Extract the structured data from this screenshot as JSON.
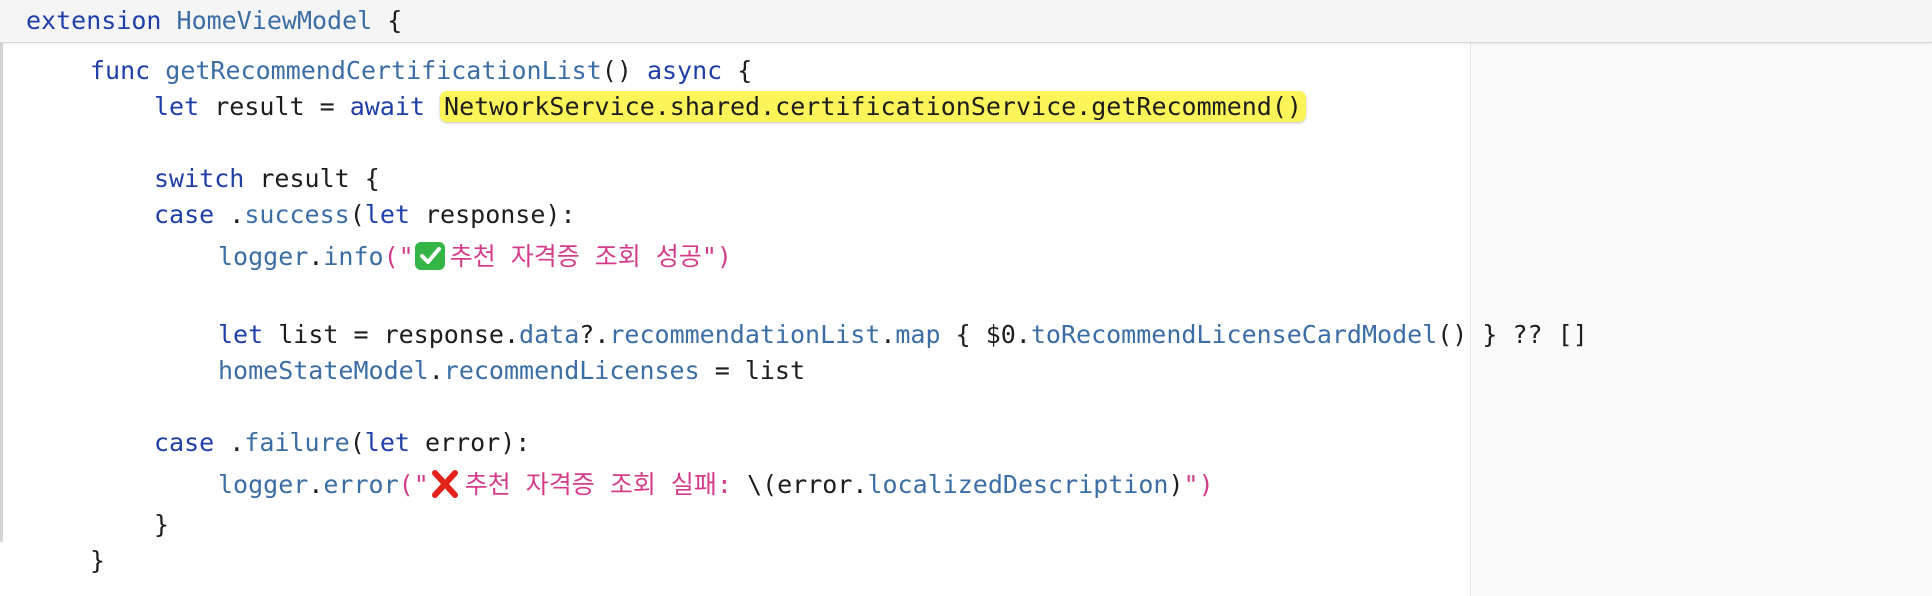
{
  "header": {
    "kw_extension": "extension",
    "type_name": "HomeViewModel",
    "brace": " {"
  },
  "code": {
    "l1": {
      "kw_func": "func",
      "fn_name": "getRecommendCertificationList",
      "parens": "()",
      "kw_async": "async",
      "brace": "{"
    },
    "l2": {
      "kw_let": "let",
      "plain": "result =",
      "kw_await": "await",
      "highlighted_call": "NetworkService.shared.certificationService.getRecommend()"
    },
    "l3": {
      "kw_switch": "switch",
      "plain": "result {"
    },
    "l4": {
      "kw_case": "case",
      "dot": ".",
      "member": "success",
      "open": "(",
      "kw_let": "let",
      "plain": "response):"
    },
    "l5": {
      "obj": "logger",
      "dot": ".",
      "method": "info",
      "open": "(\"",
      "str": "추천 자격증 조회 성공",
      "close": "\")"
    },
    "l6": {
      "kw_let": "let",
      "p1": "list = response.",
      "m1": "data",
      "p2": "?.",
      "m2": "recommendationList",
      "p3": ".",
      "m3": "map",
      "p4": "{ $0.",
      "m4": "toRecommendLicenseCardModel",
      "p5": "() } ?? []"
    },
    "l7": {
      "m1": "homeStateModel",
      "p1": ".",
      "m2": "recommendLicenses",
      "p2": "= list"
    },
    "l8": {
      "kw_case": "case",
      "dot": ".",
      "member": "failure",
      "open": "(",
      "kw_let": "let",
      "plain": "error):"
    },
    "l9": {
      "obj": "logger",
      "dot": ".",
      "method": "error",
      "open": "(\"",
      "str": "추천 자격증 조회 실패:",
      "p1": " \\(error.",
      "m1": "localizedDescription",
      "p2": ")",
      "close": "\")"
    },
    "l10": {
      "brace": "}"
    },
    "l11": {
      "brace": "}"
    }
  },
  "colors": {
    "keyword": "#1f3fa8",
    "function": "#3b6ea5",
    "string": "#d43c8a",
    "highlight": "#fbf55a"
  },
  "icons": {
    "success": "check-mark-button-emoji",
    "failure": "cross-mark-emoji"
  }
}
